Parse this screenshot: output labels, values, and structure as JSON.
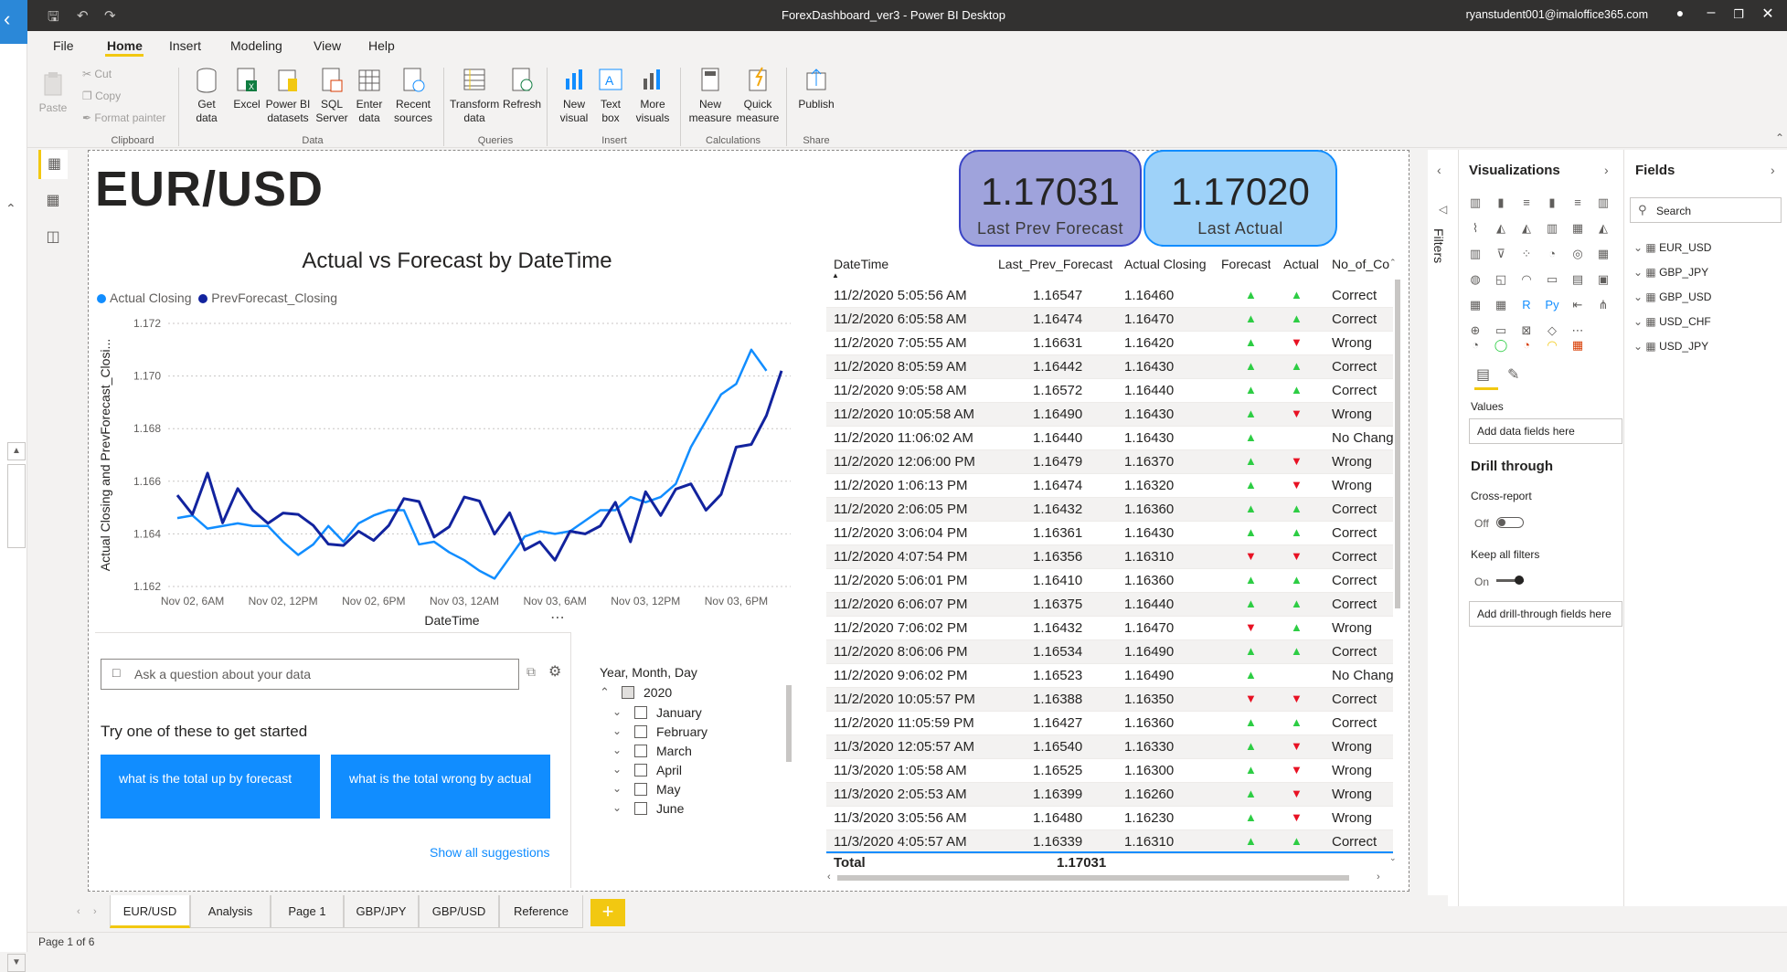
{
  "window": {
    "title": "ForexDashboard_ver3 - Power BI Desktop",
    "user": "ryanstudent001@imaloffice365.com"
  },
  "menu": [
    "File",
    "Home",
    "Insert",
    "Modeling",
    "View",
    "Help"
  ],
  "ribbon": {
    "clipboard": {
      "paste": "Paste",
      "cut": "Cut",
      "copy": "Copy",
      "format_painter": "Format painter",
      "group": "Clipboard"
    },
    "data": {
      "get_data": "Get data",
      "excel": "Excel",
      "pbi_datasets": "Power BI datasets",
      "sql": "SQL Server",
      "enter": "Enter data",
      "recent": "Recent sources",
      "group": "Data"
    },
    "queries": {
      "transform": "Transform data",
      "refresh": "Refresh",
      "group": "Queries"
    },
    "insert": {
      "new_visual": "New visual",
      "text_box": "Text box",
      "more_visuals": "More visuals",
      "group": "Insert"
    },
    "calculations": {
      "new_measure": "New measure",
      "quick_measure": "Quick measure",
      "group": "Calculations"
    },
    "share": {
      "publish": "Publish",
      "group": "Share"
    }
  },
  "page_title": "EUR/USD",
  "cards": [
    {
      "value": "1.17031",
      "label": "Last Prev Forecast",
      "color": "#9fa3dc"
    },
    {
      "value": "1.17020",
      "label": "Last Actual",
      "color": "#9ed2f9"
    }
  ],
  "chart_data": {
    "type": "line",
    "title": "Actual vs Forecast by DateTime",
    "xlabel": "DateTime",
    "ylabel": "Actual Closing and PrevForecast_Closi...",
    "ylim": [
      1.162,
      1.172
    ],
    "yticks": [
      "1.172",
      "1.170",
      "1.168",
      "1.166",
      "1.164",
      "1.162"
    ],
    "xticks": [
      "Nov 02, 6AM",
      "Nov 02, 12PM",
      "Nov 02, 6PM",
      "Nov 03, 12AM",
      "Nov 03, 6AM",
      "Nov 03, 12PM",
      "Nov 03, 6PM"
    ],
    "x_start_hour": 5,
    "grid": true,
    "series": [
      {
        "name": "Actual Closing",
        "color": "#118dff",
        "values": [
          1.1646,
          1.1647,
          1.1642,
          1.1643,
          1.1644,
          1.1643,
          1.1643,
          1.1637,
          1.1632,
          1.1636,
          1.1643,
          1.1637,
          1.1644,
          1.1647,
          1.1649,
          1.1649,
          1.1636,
          1.1637,
          1.1633,
          1.163,
          1.1626,
          1.1623,
          1.1631,
          1.1639,
          1.1641,
          1.164,
          1.1641,
          1.1645,
          1.1649,
          1.1649,
          1.1654,
          1.1652,
          1.1654,
          1.1659,
          1.1673,
          1.1683,
          1.1693,
          1.1697,
          1.171,
          1.1702
        ]
      },
      {
        "name": "PrevForecast_Closing",
        "color": "#12239e",
        "values": [
          1.16547,
          1.16474,
          1.16631,
          1.16442,
          1.16572,
          1.1649,
          1.1644,
          1.16479,
          1.16474,
          1.16432,
          1.16361,
          1.16356,
          1.1641,
          1.16375,
          1.16432,
          1.16534,
          1.16523,
          1.16388,
          1.16427,
          1.1654,
          1.16525,
          1.16399,
          1.1648,
          1.16339,
          1.1637,
          1.163,
          1.1641,
          1.164,
          1.1643,
          1.1652,
          1.1637,
          1.1656,
          1.1647,
          1.1657,
          1.1659,
          1.1649,
          1.1655,
          1.1673,
          1.1674,
          1.1685,
          1.1702
        ]
      }
    ]
  },
  "qa": {
    "placeholder": "Ask a question about your data",
    "prompt": "Try one of these to get started",
    "suggestions": [
      "what is the total up by forecast",
      "what is the total wrong by actual"
    ],
    "show_all": "Show all suggestions"
  },
  "slicer": {
    "title": "Year, Month, Day",
    "year": "2020",
    "months": [
      "January",
      "February",
      "March",
      "April",
      "May",
      "June"
    ]
  },
  "table": {
    "headers": [
      "DateTime",
      "Last_Prev_Forecast",
      "Actual Closing",
      "Forecast",
      "Actual",
      "No_of_Cor"
    ],
    "rows": [
      [
        "11/2/2020 5:05:56 AM",
        "1.16547",
        "1.16460",
        "up",
        "up",
        "Correct"
      ],
      [
        "11/2/2020 6:05:58 AM",
        "1.16474",
        "1.16470",
        "up",
        "up",
        "Correct"
      ],
      [
        "11/2/2020 7:05:55 AM",
        "1.16631",
        "1.16420",
        "up",
        "down",
        "Wrong"
      ],
      [
        "11/2/2020 8:05:59 AM",
        "1.16442",
        "1.16430",
        "up",
        "up",
        "Correct"
      ],
      [
        "11/2/2020 9:05:58 AM",
        "1.16572",
        "1.16440",
        "up",
        "up",
        "Correct"
      ],
      [
        "11/2/2020 10:05:58 AM",
        "1.16490",
        "1.16430",
        "up",
        "down",
        "Wrong"
      ],
      [
        "11/2/2020 11:06:02 AM",
        "1.16440",
        "1.16430",
        "up",
        "",
        "No Chang"
      ],
      [
        "11/2/2020 12:06:00 PM",
        "1.16479",
        "1.16370",
        "up",
        "down",
        "Wrong"
      ],
      [
        "11/2/2020 1:06:13 PM",
        "1.16474",
        "1.16320",
        "up",
        "down",
        "Wrong"
      ],
      [
        "11/2/2020 2:06:05 PM",
        "1.16432",
        "1.16360",
        "up",
        "up",
        "Correct"
      ],
      [
        "11/2/2020 3:06:04 PM",
        "1.16361",
        "1.16430",
        "up",
        "up",
        "Correct"
      ],
      [
        "11/2/2020 4:07:54 PM",
        "1.16356",
        "1.16310",
        "down",
        "down",
        "Correct"
      ],
      [
        "11/2/2020 5:06:01 PM",
        "1.16410",
        "1.16360",
        "up",
        "up",
        "Correct"
      ],
      [
        "11/2/2020 6:06:07 PM",
        "1.16375",
        "1.16440",
        "up",
        "up",
        "Correct"
      ],
      [
        "11/2/2020 7:06:02 PM",
        "1.16432",
        "1.16470",
        "down",
        "up",
        "Wrong"
      ],
      [
        "11/2/2020 8:06:06 PM",
        "1.16534",
        "1.16490",
        "up",
        "up",
        "Correct"
      ],
      [
        "11/2/2020 9:06:02 PM",
        "1.16523",
        "1.16490",
        "up",
        "",
        "No Chang"
      ],
      [
        "11/2/2020 10:05:57 PM",
        "1.16388",
        "1.16350",
        "down",
        "down",
        "Correct"
      ],
      [
        "11/2/2020 11:05:59 PM",
        "1.16427",
        "1.16360",
        "up",
        "up",
        "Correct"
      ],
      [
        "11/3/2020 12:05:57 AM",
        "1.16540",
        "1.16330",
        "up",
        "down",
        "Wrong"
      ],
      [
        "11/3/2020 1:05:58 AM",
        "1.16525",
        "1.16300",
        "up",
        "down",
        "Wrong"
      ],
      [
        "11/3/2020 2:05:53 AM",
        "1.16399",
        "1.16260",
        "up",
        "down",
        "Wrong"
      ],
      [
        "11/3/2020 3:05:56 AM",
        "1.16480",
        "1.16230",
        "up",
        "down",
        "Wrong"
      ],
      [
        "11/3/2020 4:05:57 AM",
        "1.16339",
        "1.16310",
        "up",
        "up",
        "Correct"
      ]
    ],
    "total_label": "Total",
    "total_value": "1.17031"
  },
  "visualizations": {
    "title": "Visualizations",
    "values": "Values",
    "add_data": "Add data fields here",
    "drill_through": "Drill through",
    "cross_report": "Cross-report",
    "off": "Off",
    "keep_filters": "Keep all filters",
    "on": "On",
    "add_drill": "Add drill-through fields here"
  },
  "filters": {
    "label": "Filters"
  },
  "fields": {
    "title": "Fields",
    "search": "Search",
    "tables": [
      "EUR_USD",
      "GBP_JPY",
      "GBP_USD",
      "USD_CHF",
      "USD_JPY"
    ]
  },
  "pages": [
    "EUR/USD",
    "Analysis",
    "Page 1",
    "GBP/JPY",
    "GBP/USD",
    "Reference"
  ],
  "status": "Page 1 of 6"
}
